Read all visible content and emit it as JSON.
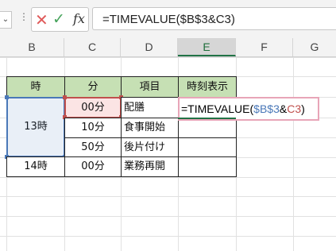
{
  "formula_bar": {
    "formula": "=TIMEVALUE($B$3&C3)",
    "fx_label": "fx"
  },
  "columns": [
    "B",
    "C",
    "D",
    "E",
    "F",
    "G"
  ],
  "active_column": "E",
  "table": {
    "headers": [
      "時",
      "分",
      "項目",
      "時刻表示"
    ],
    "rows": [
      {
        "hour": "13時",
        "minute": "00分",
        "item": "配膳"
      },
      {
        "hour": "",
        "minute": "10分",
        "item": "食事開始"
      },
      {
        "hour": "",
        "minute": "50分",
        "item": "後片付け"
      },
      {
        "hour": "14時",
        "minute": "00分",
        "item": "業務再開"
      }
    ]
  },
  "edit_cell": {
    "prefix": "=TIMEVALUE(",
    "ref1": "$B$3",
    "amp": "&",
    "ref2": "C3",
    "suffix": ")"
  },
  "colors": {
    "header_fill": "#c6e0b4",
    "ref1_color": "#4a78b8",
    "ref2_color": "#c0504d",
    "accent": "#217346"
  }
}
